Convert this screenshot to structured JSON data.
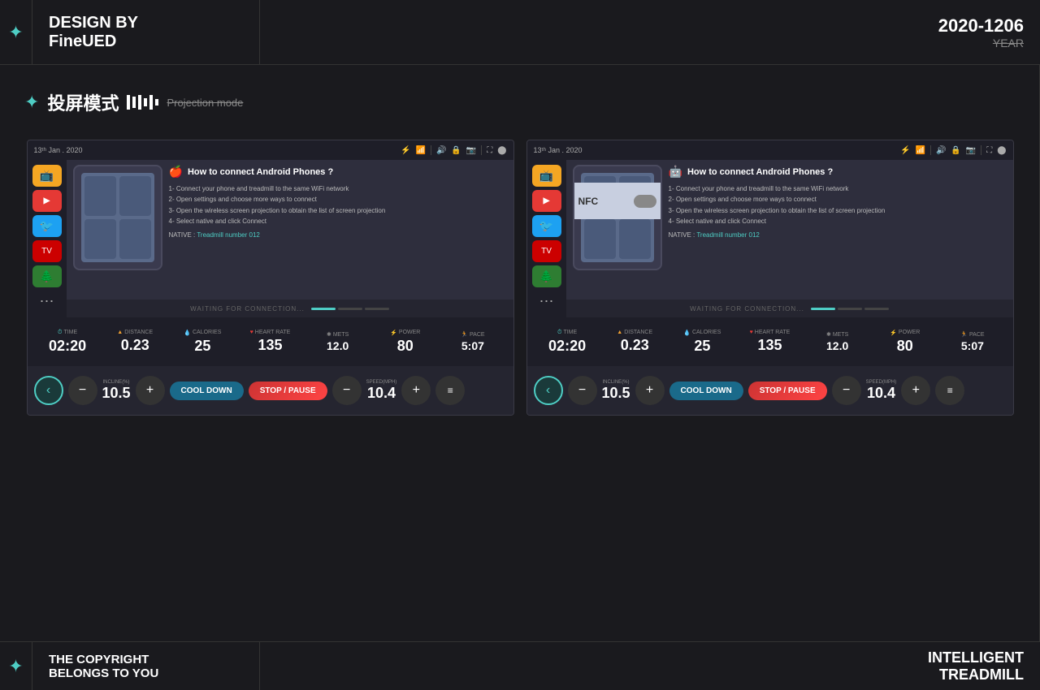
{
  "header": {
    "star_icon": "✦",
    "design_by": "DESIGN BY",
    "company": "FineUED",
    "year": "2020-1206",
    "year_label": "YEAR"
  },
  "projection": {
    "star_icon": "✦",
    "cn_text": "投屏模式",
    "en_text": "Projection mode"
  },
  "screen_left": {
    "date": "13ᵗʰ Jan . 2020",
    "connect_title": "How to connect Android Phones ?",
    "step1": "1- Connect your phone and treadmill to the same WiFi network",
    "step2": "2- Open settings and choose more ways to connect",
    "step3": "3- Open the wireless screen projection to obtain the list of screen projection",
    "step4": "4- Select native and click Connect",
    "native_label": "NATIVE :",
    "native_value": "Treadmill number 012",
    "waiting_text": "WAITING FOR CONNECTION...",
    "stats": {
      "time_label": "TIME",
      "time_value": "02:20",
      "distance_label": "DISTANCE",
      "distance_value": "0.23",
      "calories_label": "CALORIES",
      "calories_value": "25",
      "heartrate_label": "HEART RATE",
      "heartrate_value": "135",
      "mets_label": "METS",
      "mets_value": "12.0",
      "power_label": "POWER",
      "power_value": "80",
      "pace_label": "PACE",
      "pace_value": "5:07"
    },
    "controls": {
      "incline_label": "INCLINE(%)",
      "incline_value": "10.5",
      "cool_down": "COOL DOWN",
      "stop_pause": "STOP / PAUSE",
      "speed_label": "SPEED(MPH)",
      "speed_value": "10.4"
    }
  },
  "screen_right": {
    "date": "13ᵗʰ Jan . 2020",
    "connect_title": "How to connect Android Phones ?",
    "step1": "1- Connect your phone and treadmill to the same WiFi network",
    "step2": "2- Open settings and choose more ways to connect",
    "step3": "3- Open the wireless screen projection to obtain the list of screen projection",
    "step4": "4- Select native and click Connect",
    "native_label": "NATIVE :",
    "native_value": "Treadmill number 012",
    "nfc_label": "NFC",
    "waiting_text": "WAITING FOR CONNECTION...",
    "stats": {
      "time_label": "TIME",
      "time_value": "02:20",
      "distance_label": "DISTANCE",
      "distance_value": "0.23",
      "calories_label": "CALORIES",
      "calories_value": "25",
      "heartrate_label": "HEART RATE",
      "heartrate_value": "135",
      "mets_label": "METS",
      "mets_value": "12.0",
      "power_label": "POWER",
      "power_value": "80",
      "pace_label": "PACE",
      "pace_value": "5:07"
    },
    "controls": {
      "incline_label": "INCLINE(%)",
      "incline_value": "10.5",
      "cool_down": "COOL DOWN",
      "stop_pause": "STOP / PAUSE",
      "speed_label": "SPEED(MPH)",
      "speed_value": "10.4"
    }
  },
  "footer": {
    "star_icon": "✦",
    "line1": "THE COPYRIGHT",
    "line2": "BELONGS TO YOU",
    "brand1": "INTELLIGENT",
    "brand2": "TREADMILL"
  }
}
